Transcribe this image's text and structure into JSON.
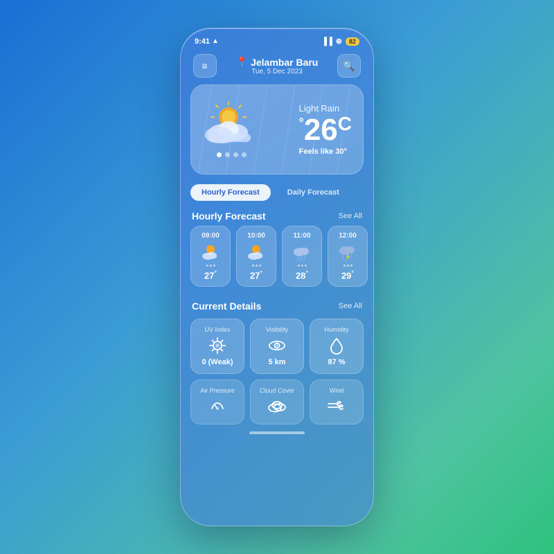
{
  "status": {
    "time": "9:41",
    "battery": "82"
  },
  "header": {
    "menu_icon": "☰",
    "location_pin": "📍",
    "location_name": "Jelambar Baru",
    "date": "Tue, 5 Dec 2023",
    "search_icon": "🔍"
  },
  "weather_main": {
    "condition": "Light Rain",
    "temperature": "26",
    "unit": "C",
    "feels_like_label": "Feels like",
    "feels_like_value": "30"
  },
  "tabs": [
    {
      "label": "Hourly Forecast",
      "active": true
    },
    {
      "label": "Daily Forecast",
      "active": false
    }
  ],
  "hourly_section": {
    "title": "Hourly Forecast",
    "see_all": "See All"
  },
  "hourly_items": [
    {
      "time": "09:00",
      "icon": "partly-sunny",
      "temp": "27"
    },
    {
      "time": "10:00",
      "icon": "partly-sunny",
      "temp": "27"
    },
    {
      "time": "11:00",
      "icon": "rainy",
      "temp": "28"
    },
    {
      "time": "12:00",
      "icon": "thunder-rain",
      "temp": "29"
    }
  ],
  "details_section": {
    "title": "Current Details",
    "see_all": "See All"
  },
  "detail_items": [
    {
      "label": "UV Index",
      "icon": "☀️",
      "value": "0 (Weak)"
    },
    {
      "label": "Visibility",
      "icon": "👁",
      "value": "5 km"
    },
    {
      "label": "Humidity",
      "icon": "💧",
      "value": "87 %"
    }
  ],
  "bottom_items": [
    {
      "label": "Air Pressure",
      "icon": "🌀"
    },
    {
      "label": "Cloud Cover",
      "icon": "⛅"
    },
    {
      "label": "Wind",
      "icon": "💨"
    }
  ]
}
